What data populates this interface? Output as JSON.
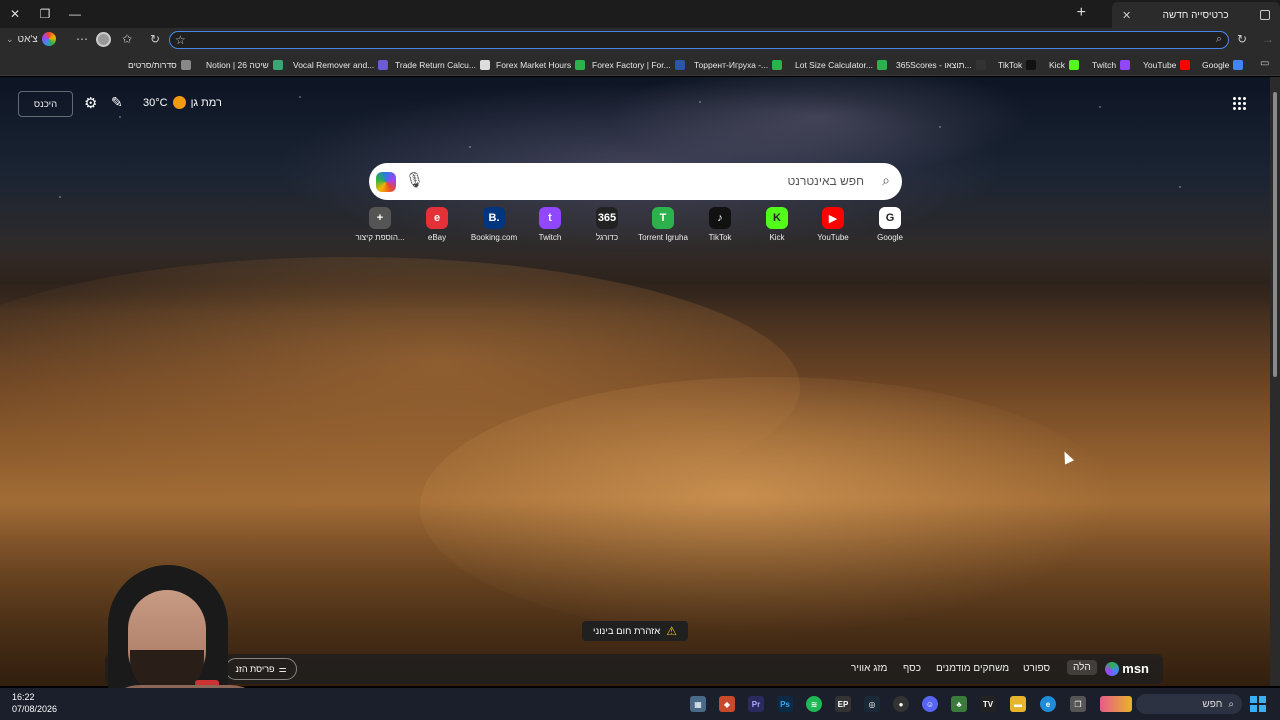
{
  "browser": {
    "tab_title": "כרטיסייה חדשה",
    "profile_label": "צ'אט",
    "address_value": ""
  },
  "bookmarks": [
    {
      "label": "סדרות/סרטים",
      "color": "#888888"
    },
    {
      "label": "Notion | שיטה 26",
      "color": "#3aa675"
    },
    {
      "label": "Vocal Remover and...",
      "color": "#6b5bd6"
    },
    {
      "label": "Trade Return Calcu...",
      "color": "#dddddd"
    },
    {
      "label": "Forex Market Hours",
      "color": "#2bb24c"
    },
    {
      "label": "Forex Factory | For...",
      "color": "#2b57a8"
    },
    {
      "label": "Торрент-Игруха -...",
      "color": "#2bb24c"
    },
    {
      "label": "Lot Size Calculator...",
      "color": "#2bb24c"
    },
    {
      "label": "365Scores - תוצאו...",
      "color": "#333333"
    },
    {
      "label": "TikTok",
      "color": "#111111"
    },
    {
      "label": "Kick",
      "color": "#53fc18"
    },
    {
      "label": "Twitch",
      "color": "#9146ff"
    },
    {
      "label": "YouTube",
      "color": "#ff0000"
    },
    {
      "label": "Google",
      "color": "#4285f4"
    }
  ],
  "ntp": {
    "signin_label": "היכנס",
    "temperature": "30°C",
    "city": "רמת גן",
    "search_placeholder": "חפש באינטרנט",
    "tiles": [
      {
        "label": "הוספת קיצור...",
        "glyph": "+",
        "color": "#555555"
      },
      {
        "label": "eBay",
        "glyph": "e",
        "color": "#e43137"
      },
      {
        "label": "Booking.com",
        "glyph": "B.",
        "color": "#003580"
      },
      {
        "label": "Twitch",
        "glyph": "t",
        "color": "#9146ff"
      },
      {
        "label": "כדורגל",
        "glyph": "365",
        "color": "#222222"
      },
      {
        "label": "Torrent Igruha",
        "glyph": "T",
        "color": "#2bb24c"
      },
      {
        "label": "TikTok",
        "glyph": "♪",
        "color": "#111111"
      },
      {
        "label": "Kick",
        "glyph": "K",
        "color": "#53fc18"
      },
      {
        "label": "YouTube",
        "glyph": "▶",
        "color": "#ff0000"
      },
      {
        "label": "Google",
        "glyph": "G",
        "color": "#ffffff"
      }
    ],
    "alert_text": "אזהרת חום בינוני",
    "feed": {
      "brand": "msn",
      "tabs": [
        "הלה",
        "ספורט",
        "משחקים מודמנים",
        "כסף",
        "מזג אוויר"
      ],
      "layout_label": "פריסת הזנ"
    }
  },
  "taskbar": {
    "time": "16:22",
    "date": "07/08/2026",
    "search_label": "חפש"
  }
}
